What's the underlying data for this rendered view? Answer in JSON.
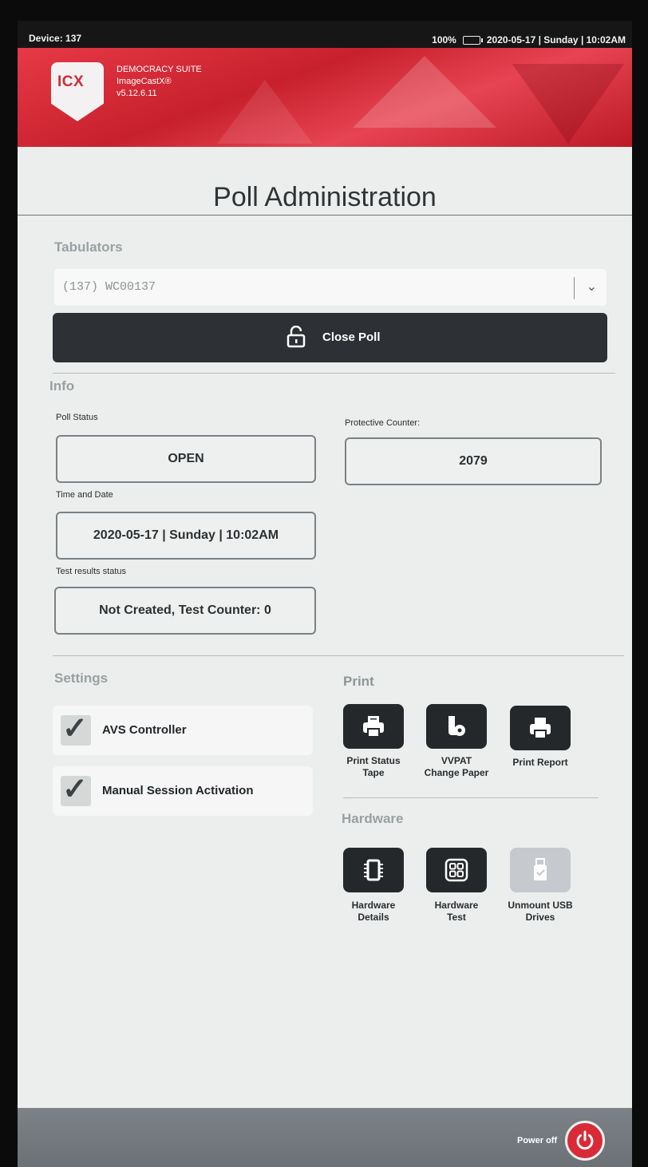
{
  "status_bar": {
    "device": "Device: 137",
    "battery": "100%",
    "datetime": "2020-05-17 | Sunday | 10:02AM"
  },
  "header": {
    "logo_text": "ICX",
    "brand_line1": "DEMOCRACY SUITE",
    "brand_line2": "ImageCastX®",
    "brand_line3": "v5.12.6.11"
  },
  "page": {
    "title": "Poll Administration"
  },
  "tabulators": {
    "heading": "Tabulators",
    "selected": "(137) WC00137",
    "close_poll_label": "Close Poll"
  },
  "info": {
    "heading": "Info",
    "poll_status_label": "Poll Status",
    "poll_status_value": "OPEN",
    "protective_counter_label": "Protective Counter:",
    "protective_counter_value": "2079",
    "time_date_label": "Time and Date",
    "time_date_value": "2020-05-17 | Sunday | 10:02AM",
    "test_results_label": "Test results status",
    "test_results_value": "Not Created, Test Counter: 0"
  },
  "settings": {
    "heading": "Settings",
    "items": [
      {
        "label": "AVS Controller",
        "checked": true
      },
      {
        "label": "Manual Session Activation",
        "checked": true
      }
    ]
  },
  "print": {
    "heading": "Print",
    "items": [
      {
        "line1": "Print Status",
        "line2": "Tape",
        "icon": "printer-icon"
      },
      {
        "line1": "VVPAT",
        "line2": "Change Paper",
        "icon": "paper-roll-icon"
      },
      {
        "line1": "Print Report",
        "line2": "",
        "icon": "printer-icon"
      }
    ]
  },
  "hardware": {
    "heading": "Hardware",
    "items": [
      {
        "line1": "Hardware",
        "line2": "Details",
        "icon": "chip-icon"
      },
      {
        "line1": "Hardware",
        "line2": "Test",
        "icon": "grid-icon"
      },
      {
        "line1": "Unmount USB",
        "line2": "Drives",
        "icon": "usb-icon",
        "disabled": true
      }
    ]
  },
  "footer": {
    "power_off_label": "Power off"
  },
  "colors": {
    "header_red": "#d12a35",
    "dark_button": "#2d3034",
    "power_red": "#d82a37"
  }
}
